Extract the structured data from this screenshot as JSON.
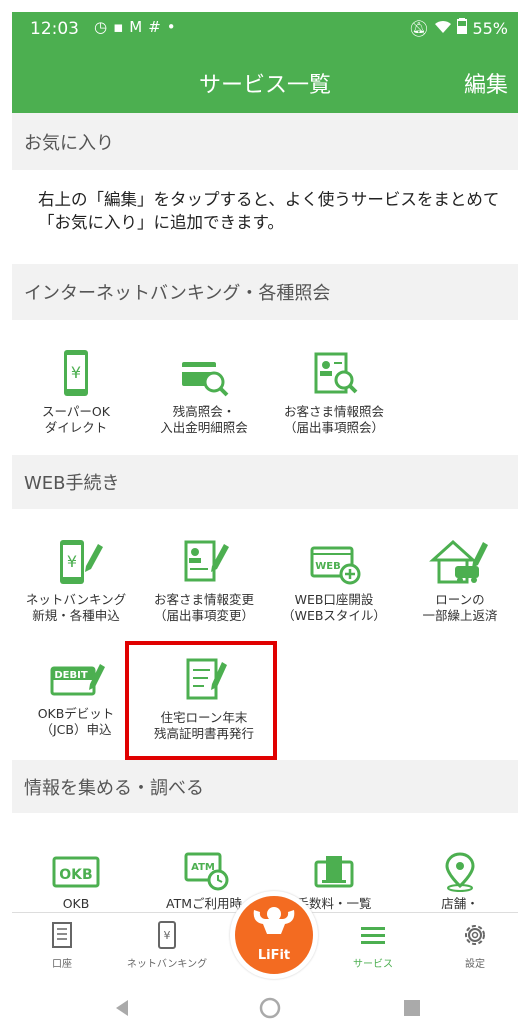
{
  "status": {
    "time": "12:03",
    "battery": "55%",
    "icons": [
      "alarm-icon",
      "news-icon",
      "gmail-icon",
      "slack-icon",
      "dot-icon",
      "mute-icon",
      "wifi-icon",
      "battery-icon"
    ]
  },
  "appbar": {
    "title": "サービス一覧",
    "edit": "編集"
  },
  "favorites": {
    "header": "お気に入り",
    "description": "右上の「編集」をタップすると、よく使うサービスをまとめて「お気に入り」に追加できます。"
  },
  "internet_banking": {
    "header": "インターネットバンキング・各種照会",
    "items": [
      {
        "line1": "スーパーOK",
        "line2": "ダイレクト",
        "icon": "phone-yen-icon"
      },
      {
        "line1": "残高照会・",
        "line2": "入出金明細照会",
        "icon": "card-search-icon"
      },
      {
        "line1": "お客さま情報照会",
        "line2": "（届出事項照会）",
        "icon": "profile-search-icon"
      }
    ]
  },
  "web_procedures": {
    "header": "WEB手続き",
    "items": [
      {
        "line1": "ネットバンキング",
        "line2": "新規・各種申込",
        "icon": "phone-yen-pen-icon"
      },
      {
        "line1": "お客さま情報変更",
        "line2": "（届出事項変更）",
        "icon": "profile-edit-icon"
      },
      {
        "line1": "WEB口座開設",
        "line2": "（WEBスタイル）",
        "icon": "web-account-open-icon",
        "icon_text": "WEB"
      },
      {
        "line1": "ローンの",
        "line2": "一部繰上返済",
        "icon": "house-car-pen-icon"
      },
      {
        "line1": "OKBデビット",
        "line2": "（JCB）申込",
        "icon": "debit-card-pen-icon",
        "icon_text": "DEBIT"
      },
      {
        "line1": "住宅ローン年末",
        "line2": "残高証明書再発行",
        "icon": "document-edit-icon"
      }
    ]
  },
  "info": {
    "header": "情報を集める・調べる",
    "items": [
      {
        "label": "OKB",
        "icon": "okb-logo-icon",
        "icon_text": "OKB"
      },
      {
        "label": "ATMご利用時",
        "icon": "atm-clock-icon",
        "icon_text": "ATM"
      },
      {
        "label": "手数料・一覧",
        "icon": "atm-card-icon"
      },
      {
        "label": "店舗・",
        "icon": "location-pin-icon"
      }
    ]
  },
  "bottom_nav": {
    "items": [
      {
        "label": "口座",
        "icon": "passbook-icon"
      },
      {
        "label": "ネットバンキング",
        "icon": "phone-yen-icon"
      },
      {
        "label": "LiFit",
        "icon": "lifit-muscle-icon"
      },
      {
        "label": "サービス",
        "icon": "menu-icon"
      },
      {
        "label": "設定",
        "icon": "gear-icon"
      }
    ],
    "active": "サービス"
  },
  "colors": {
    "brand_green": "#4caf50",
    "highlight_red": "#e00000",
    "lifit_orange": "#f36b21",
    "section_bg": "#f2f2f2"
  }
}
